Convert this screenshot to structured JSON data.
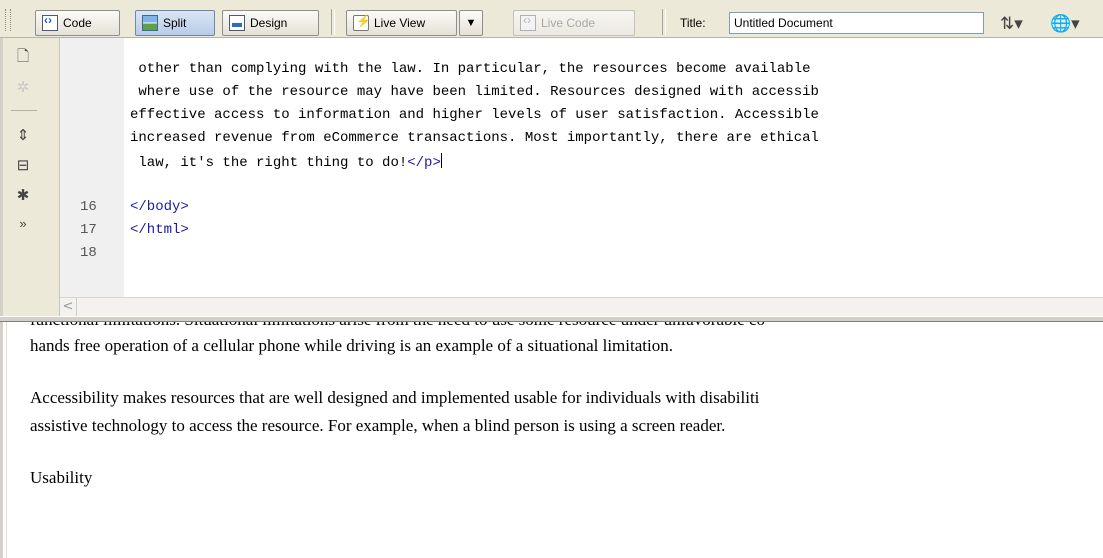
{
  "toolbar": {
    "code_label": "Code",
    "split_label": "Split",
    "design_label": "Design",
    "live_view_label": "Live View",
    "live_code_label": "Live Code",
    "title_label": "Title:",
    "title_value": "Untitled Document",
    "active_view": "Split"
  },
  "code_view": {
    "wrapped_lines": [
      " other than complying with the law. In particular, the resources become available",
      " where use of the resource may have been limited. Resources designed with accessib",
      "effective access to information and higher levels of user satisfaction. Accessible",
      "increased revenue from eCommerce transactions. Most importantly, there are ethical",
      " law, it's the right thing to do!"
    ],
    "closing_p_tag": "</p>",
    "numbered_lines": [
      {
        "number": "16",
        "code": "</body>"
      },
      {
        "number": "17",
        "code": "</html>"
      },
      {
        "number": "18",
        "code": ""
      }
    ]
  },
  "design_view": {
    "cut_line": "functional limitations. Situational limitations arise from the need to use some resource under unfavorable co",
    "para1_line2": "hands free operation of a cellular phone while driving is an example of a situational limitation.",
    "para2_line1": "Accessibility makes resources that are well designed and implemented usable for individuals with disabiliti",
    "para2_line2": "assistive technology to access the resource. For example, when a blind person is using a screen reader.",
    "heading": "Usability"
  },
  "colors": {
    "toolbar_bg": "#ece9d8",
    "tag_color": "#1a1aa6",
    "gutter_bg": "#f0f0f0"
  },
  "icons": [
    "code-view-icon",
    "split-view-icon",
    "design-view-icon",
    "live-view-icon",
    "live-code-icon",
    "file-management-icon",
    "preview-browser-icon",
    "open-documents-icon",
    "collapse-tag-icon",
    "expand-all-icon",
    "select-parent-tag-icon",
    "balance-braces-icon",
    "more-options-icon"
  ]
}
